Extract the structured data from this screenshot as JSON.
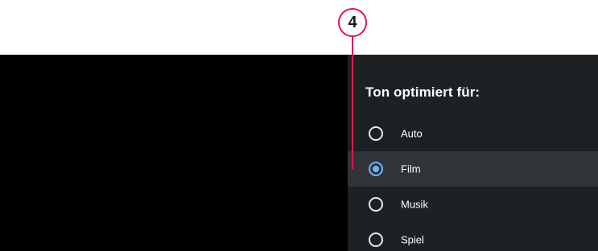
{
  "callout": {
    "number": "4",
    "color": "#d9194f"
  },
  "panel": {
    "title": "Ton optimiert für:",
    "background": "#1e2124",
    "selected_background": "#303438",
    "accent": "#6cb4ff",
    "options": [
      {
        "label": "Auto",
        "selected": false,
        "icon": "radio-unchecked-icon"
      },
      {
        "label": "Film",
        "selected": true,
        "icon": "radio-checked-icon"
      },
      {
        "label": "Musik",
        "selected": false,
        "icon": "radio-unchecked-icon"
      },
      {
        "label": "Spiel",
        "selected": false,
        "icon": "radio-unchecked-icon"
      }
    ]
  }
}
